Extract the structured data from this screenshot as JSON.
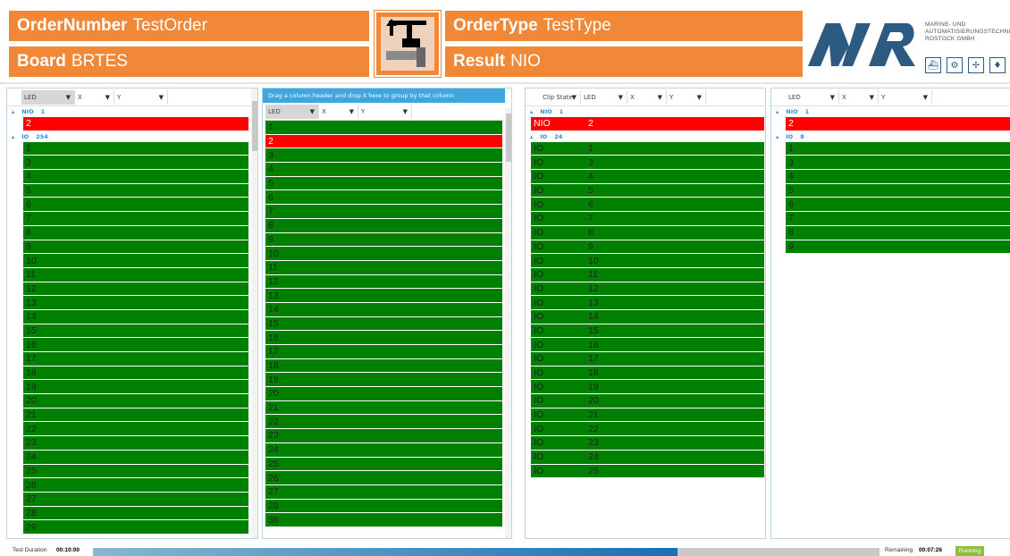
{
  "header": {
    "order_number_label": "OrderNumber",
    "order_number_value": "TestOrder",
    "board_label": "Board",
    "board_value": "BRTES",
    "order_type_label": "OrderType",
    "order_type_value": "TestType",
    "result_label": "Result",
    "result_value": "NIO",
    "machine_icon": "station-machine-icon",
    "accent_color": "#f08838"
  },
  "logo": {
    "mark": "MAR",
    "line1": "MARINE- UND",
    "line2": "AUTOMATISIERUNGSTECHNIK",
    "line3": "ROSTOCK GMBH",
    "brand_color": "#2d5a80",
    "icons": [
      "marine-icon",
      "gear-icon",
      "wind-turbine-icon",
      "machine-icon"
    ]
  },
  "panel1": {
    "columns": [
      "LED",
      "X",
      "Y"
    ],
    "groups": [
      {
        "name": "NIO",
        "count": "1",
        "rows": [
          "2"
        ]
      },
      {
        "name": "IO",
        "count": "254",
        "rows": [
          "1",
          "3",
          "4",
          "5",
          "6",
          "7",
          "8",
          "9",
          "10",
          "11",
          "12",
          "13",
          "14",
          "15",
          "16",
          "17",
          "18",
          "19",
          "20",
          "21",
          "22",
          "23",
          "24",
          "25",
          "26",
          "27",
          "28",
          "29"
        ]
      }
    ]
  },
  "panel2": {
    "drag_hint": "Drag a column header and drop it here to group by that column",
    "columns": [
      "LED",
      "X",
      "Y"
    ],
    "rows": [
      {
        "v": "1",
        "s": "g"
      },
      {
        "v": "2",
        "s": "r"
      },
      {
        "v": "3",
        "s": "g"
      },
      {
        "v": "4",
        "s": "g"
      },
      {
        "v": "5",
        "s": "g"
      },
      {
        "v": "6",
        "s": "g"
      },
      {
        "v": "7",
        "s": "g"
      },
      {
        "v": "8",
        "s": "g"
      },
      {
        "v": "9",
        "s": "g"
      },
      {
        "v": "10",
        "s": "g"
      },
      {
        "v": "11",
        "s": "g"
      },
      {
        "v": "12",
        "s": "g"
      },
      {
        "v": "13",
        "s": "g"
      },
      {
        "v": "14",
        "s": "g"
      },
      {
        "v": "15",
        "s": "g"
      },
      {
        "v": "16",
        "s": "g"
      },
      {
        "v": "17",
        "s": "g"
      },
      {
        "v": "18",
        "s": "g"
      },
      {
        "v": "19",
        "s": "g"
      },
      {
        "v": "20",
        "s": "g"
      },
      {
        "v": "21",
        "s": "g"
      },
      {
        "v": "22",
        "s": "g"
      },
      {
        "v": "23",
        "s": "g"
      },
      {
        "v": "24",
        "s": "g"
      },
      {
        "v": "25",
        "s": "g"
      },
      {
        "v": "26",
        "s": "g"
      },
      {
        "v": "27",
        "s": "g"
      },
      {
        "v": "28",
        "s": "g"
      },
      {
        "v": "38",
        "s": "g"
      }
    ]
  },
  "panel3": {
    "columns": [
      "Clip State",
      "LED",
      "X",
      "Y"
    ],
    "groups": [
      {
        "name": "NIO",
        "count": "1",
        "rows": [
          [
            "NIO",
            "2"
          ]
        ]
      },
      {
        "name": "IO",
        "count": "24",
        "rows": [
          [
            "IO",
            "1"
          ],
          [
            "IO",
            "3"
          ],
          [
            "IO",
            "4"
          ],
          [
            "IO",
            "5"
          ],
          [
            "IO",
            "6"
          ],
          [
            "IO",
            "7"
          ],
          [
            "IO",
            "8"
          ],
          [
            "IO",
            "9"
          ],
          [
            "IO",
            "10"
          ],
          [
            "IO",
            "11"
          ],
          [
            "IO",
            "12"
          ],
          [
            "IO",
            "13"
          ],
          [
            "IO",
            "14"
          ],
          [
            "IO",
            "15"
          ],
          [
            "IO",
            "16"
          ],
          [
            "IO",
            "17"
          ],
          [
            "IO",
            "18"
          ],
          [
            "IO",
            "19"
          ],
          [
            "IO",
            "20"
          ],
          [
            "IO",
            "21"
          ],
          [
            "IO",
            "22"
          ],
          [
            "IO",
            "23"
          ],
          [
            "IO",
            "24"
          ],
          [
            "IO",
            "25"
          ]
        ]
      }
    ]
  },
  "panel4": {
    "columns": [
      "LED",
      "X",
      "Y"
    ],
    "groups": [
      {
        "name": "NIO",
        "count": "1",
        "rows": [
          "2"
        ]
      },
      {
        "name": "IO",
        "count": "8",
        "rows": [
          "1",
          "3",
          "4",
          "5",
          "6",
          "7",
          "8",
          "9"
        ]
      }
    ]
  },
  "footer": {
    "duration_label": "Test Duration",
    "duration_value": "00:10:00",
    "remaining_label": "Remaining",
    "remaining_value": "00:07:26",
    "status": "Running",
    "progress_fraction": 0.743,
    "status_color": "#8cbf3a"
  }
}
